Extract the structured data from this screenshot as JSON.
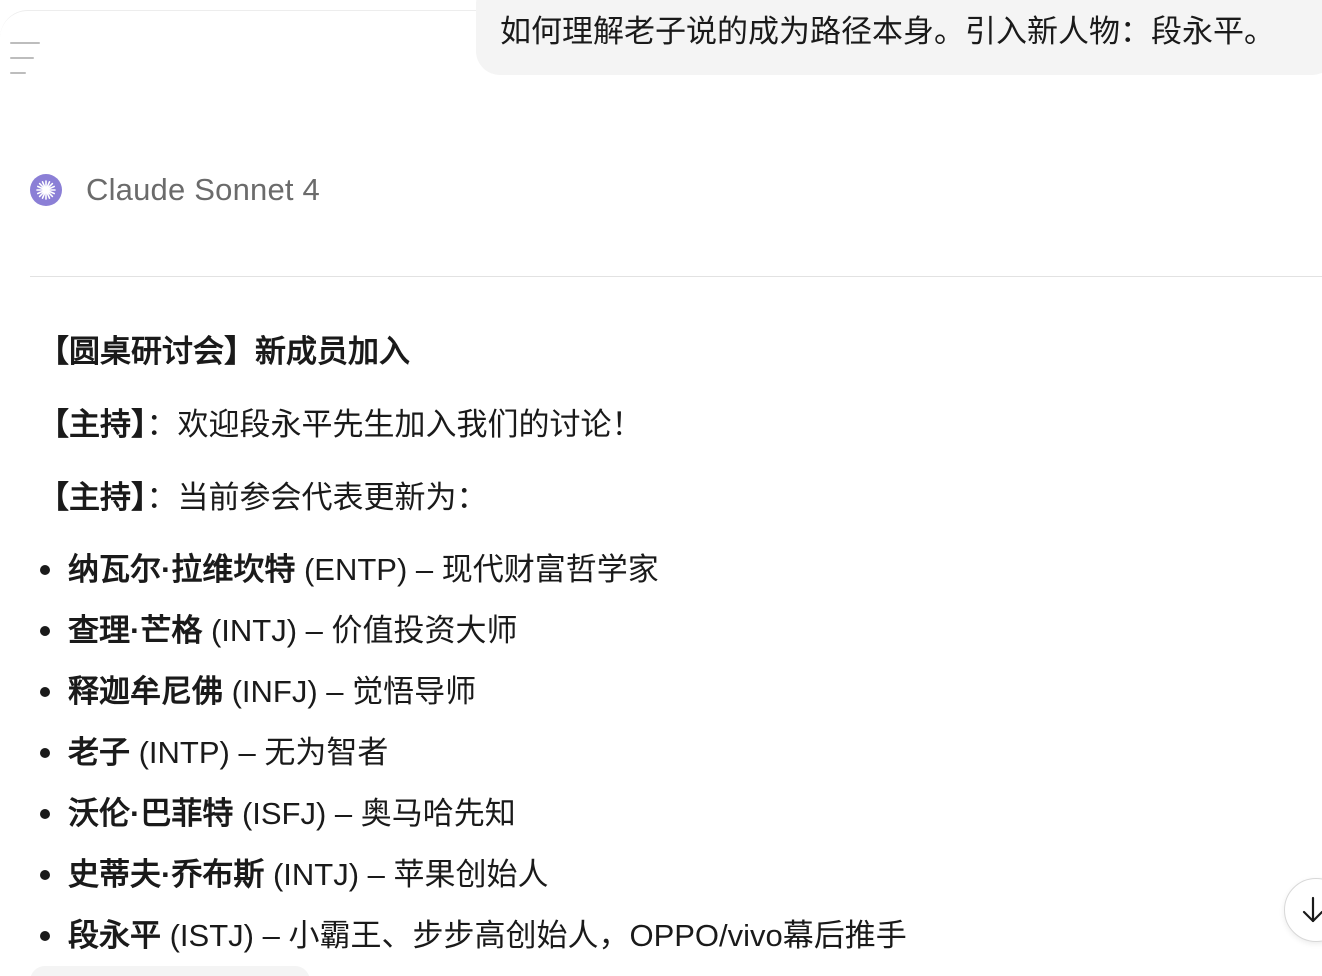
{
  "user_message": {
    "text": "如何理解老子说的成为路径本身。引入新人物：段永平。"
  },
  "model": {
    "name": "Claude Sonnet 4",
    "icon": "claude-sparkle-icon",
    "icon_color": "#8b7fd6"
  },
  "response": {
    "heading": "【圆桌研讨会】新成员加入",
    "paragraphs": [
      {
        "speaker": "【主持】",
        "text": "：欢迎段永平先生加入我们的讨论！"
      },
      {
        "speaker": "【主持】",
        "text": "：当前参会代表更新为："
      }
    ],
    "participants": [
      {
        "name": "纳瓦尔·拉维坎特",
        "desc": " (ENTP) – 现代财富哲学家"
      },
      {
        "name": "查理·芒格",
        "desc": " (INTJ) – 价值投资大师"
      },
      {
        "name": "释迦牟尼佛",
        "desc": " (INFJ) – 觉悟导师"
      },
      {
        "name": "老子",
        "desc": " (INTP) – 无为智者"
      },
      {
        "name": "沃伦·巴菲特",
        "desc": " (ISFJ) – 奥马哈先知"
      },
      {
        "name": "史蒂夫·乔布斯",
        "desc": " (INTJ) – 苹果创始人"
      },
      {
        "name": "段永平",
        "desc": " (ISTJ) – 小霸王、步步高创始人，OPPO/vivo幕后推手"
      }
    ]
  },
  "icons": {
    "menu": "menu-icon",
    "scroll_down": "arrow-down-icon"
  }
}
